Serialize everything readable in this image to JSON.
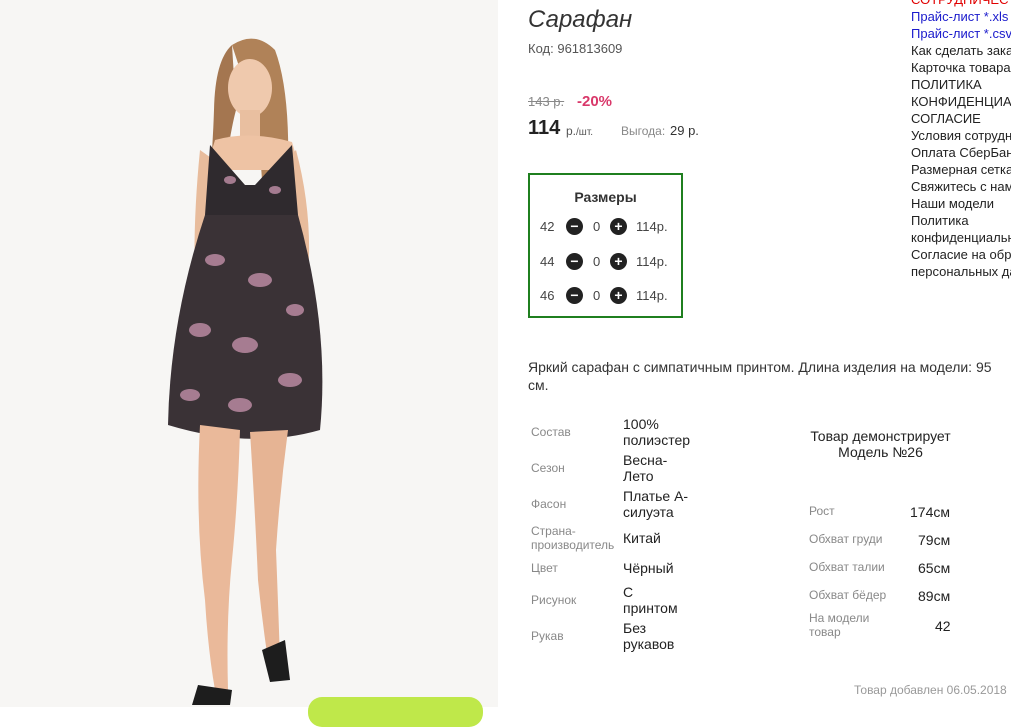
{
  "product": {
    "title": "Сарафан",
    "code_label": "Код:",
    "code_value": "961813609",
    "old_price": "143 р.",
    "discount": "-20%",
    "price": "114",
    "unit_r": "р.",
    "unit_per": "/шт.",
    "benefit_label": "Выгода:",
    "benefit_value": "29 р."
  },
  "sizes": {
    "title": "Размеры",
    "rows": [
      {
        "size": "42",
        "qty": "0",
        "price": "114р."
      },
      {
        "size": "44",
        "qty": "0",
        "price": "114р."
      },
      {
        "size": "46",
        "qty": "0",
        "price": "114р."
      }
    ],
    "minus_symbol": "−",
    "plus_symbol": "+"
  },
  "description": "Яркий сарафан с симпатичным принтом. Длина изделия на модели: 95 см.",
  "properties": [
    {
      "label": "Состав",
      "value": "100% полиэстер"
    },
    {
      "label": "Сезон",
      "value": "Весна-Лето"
    },
    {
      "label": "Фасон",
      "value": "Платье А-силуэта"
    },
    {
      "label": "Страна-производитель",
      "value": "Китай"
    },
    {
      "label": "Цвет",
      "value": "Чёрный"
    },
    {
      "label": "Рисунок",
      "value": "С принтом"
    },
    {
      "label": "Рукав",
      "value": "Без рукавов"
    }
  ],
  "model": {
    "heading": "Товар демонстрирует Модель №26",
    "measures": [
      {
        "label": "Рост",
        "value": "174см"
      },
      {
        "label": "Обхват груди",
        "value": "79см"
      },
      {
        "label": "Обхват талии",
        "value": "65см"
      },
      {
        "label": "Обхват бёдер",
        "value": "89см"
      },
      {
        "label": "На модели товар",
        "value": "42"
      }
    ]
  },
  "added": "Товар добавлен 06.05.2018",
  "side_menu": [
    "СОТРУДНИЧЕСТ",
    "Прайс-лист *.xls",
    "Прайс-лист *.csv",
    "Как сделать заказ",
    "Карточка товара",
    "ПОЛИТИКА",
    "КОНФИДЕНЦИАЛЬ",
    "СОГЛАСИЕ",
    "Условия сотрудн",
    "Оплата СберБанк",
    "Размерная сетка",
    "Свяжитесь с нами",
    "Наши модели",
    "Политика",
    "конфиденциальн",
    "Согласие на обр",
    "персональных да"
  ],
  "colors": {
    "discount": "#d9386a",
    "sizes_border": "#1f7f1f",
    "link_blue": "#1a1acc",
    "link_red": "#e00000",
    "green_button": "#bfe84a"
  }
}
